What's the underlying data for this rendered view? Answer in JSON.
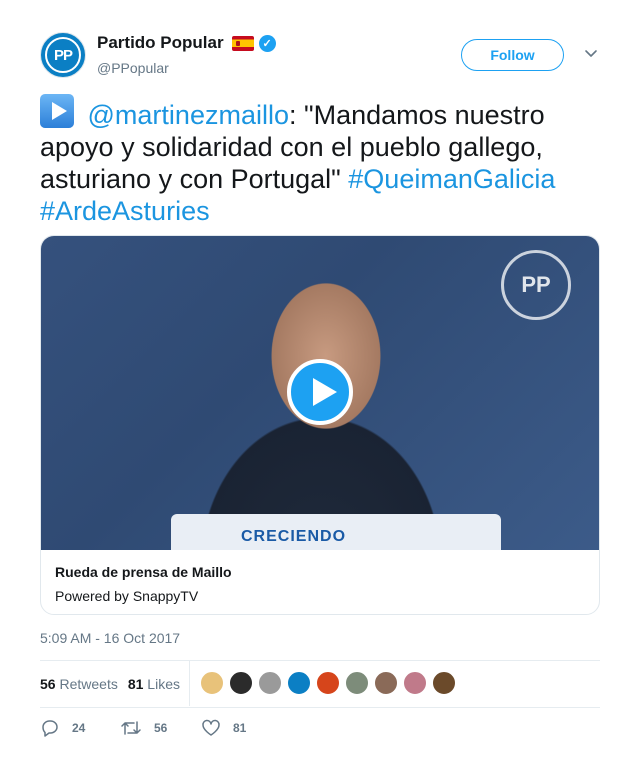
{
  "author": {
    "name": "Partido Popular",
    "handle": "@PPopular",
    "avatar_text": "PP",
    "flag_icon": "spain-flag-icon",
    "verified_icon": "verified-badge-icon"
  },
  "follow_label": "Follow",
  "tweet": {
    "mention": "@martinezmaillo",
    "text": ": \"Mandamos nuestro apoyo y solidaridad con el pueblo gallego, asturiano y con Portugal\"",
    "hashtag1": "#QueimanGalicia",
    "hashtag2": "#ArdeAsturies"
  },
  "card": {
    "title": "Rueda de prensa de Maillo",
    "subtitle": "Powered by SnappyTV",
    "logo_text": "PP",
    "podium_text": "CRECIENDO"
  },
  "timestamp": "5:09 AM - 16 Oct 2017",
  "stats": {
    "retweets_count": "56",
    "retweets_label": "Retweets",
    "likes_count": "81",
    "likes_label": "Likes"
  },
  "likers": [
    "#e8c27a",
    "#2b2b2b",
    "#9a9a9a",
    "#0b7fc4",
    "#d6451b",
    "#7d8c7a",
    "#8a6a58",
    "#c07a8a",
    "#6b4a2a"
  ],
  "actions": {
    "reply_count": "24",
    "retweet_count": "56",
    "like_count": "81"
  },
  "colors": {
    "accent": "#1da1f2",
    "link": "#1b95e0",
    "muted": "#657786"
  }
}
